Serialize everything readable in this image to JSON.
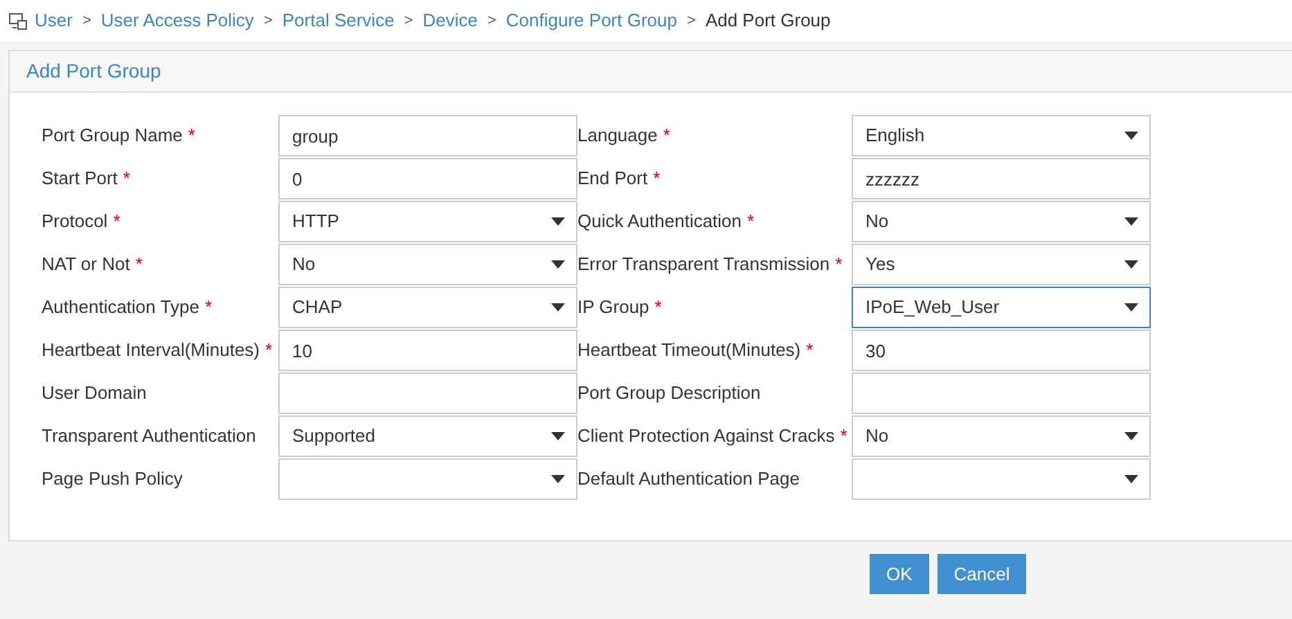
{
  "breadcrumb": [
    {
      "label": "User",
      "current": false
    },
    {
      "separator": ">",
      "label": "User Access Policy",
      "current": false
    },
    {
      "separator": ">",
      "label": "Portal Service",
      "current": false
    },
    {
      "separator": ">",
      "label": "Device",
      "current": false
    },
    {
      "separator": ">",
      "label": "Configure Port Group",
      "current": false
    },
    {
      "separator": ">",
      "label": "Add Port Group",
      "current": true
    }
  ],
  "panel": {
    "title": "Add Port Group"
  },
  "fields": [
    {
      "label": "Port Group Name",
      "required_mark": "*",
      "kind": "text",
      "value": "group",
      "focused": false
    },
    {
      "label": "Language",
      "required_mark": "*",
      "kind": "select",
      "value": "English",
      "focused": false
    },
    {
      "label": "Start Port",
      "required_mark": "*",
      "kind": "text",
      "value": "0",
      "focused": false
    },
    {
      "label": "End Port",
      "required_mark": "*",
      "kind": "text",
      "value": "zzzzzz",
      "focused": false
    },
    {
      "label": "Protocol",
      "required_mark": "*",
      "kind": "select",
      "value": "HTTP",
      "focused": false
    },
    {
      "label": "Quick Authentication",
      "required_mark": "*",
      "kind": "select",
      "value": "No",
      "focused": false
    },
    {
      "label": "NAT or Not",
      "required_mark": "*",
      "kind": "select",
      "value": "No",
      "focused": false
    },
    {
      "label": "Error Transparent Transmission",
      "required_mark": "*",
      "kind": "select",
      "value": "Yes",
      "focused": false
    },
    {
      "label": "Authentication Type",
      "required_mark": "*",
      "kind": "select",
      "value": "CHAP",
      "focused": false
    },
    {
      "label": "IP Group",
      "required_mark": "*",
      "kind": "select",
      "value": "IPoE_Web_User",
      "focused": true
    },
    {
      "label": "Heartbeat Interval(Minutes)",
      "required_mark": "*",
      "kind": "text",
      "value": "10",
      "focused": false
    },
    {
      "label": "Heartbeat Timeout(Minutes)",
      "required_mark": "*",
      "kind": "text",
      "value": "30",
      "focused": false
    },
    {
      "label": "User Domain",
      "kind": "text",
      "focused": false
    },
    {
      "label": "Port Group Description",
      "kind": "text",
      "focused": false
    },
    {
      "label": "Transparent Authentication",
      "kind": "select",
      "value": "Supported",
      "focused": false
    },
    {
      "label": "Client Protection Against Cracks",
      "required_mark": "*",
      "kind": "select",
      "value": "No",
      "focused": false
    },
    {
      "label": "Page Push Policy",
      "kind": "select",
      "focused": false
    },
    {
      "label": "Default Authentication Page",
      "kind": "select",
      "focused": false
    }
  ],
  "buttons": [
    "OK",
    "Cancel"
  ]
}
